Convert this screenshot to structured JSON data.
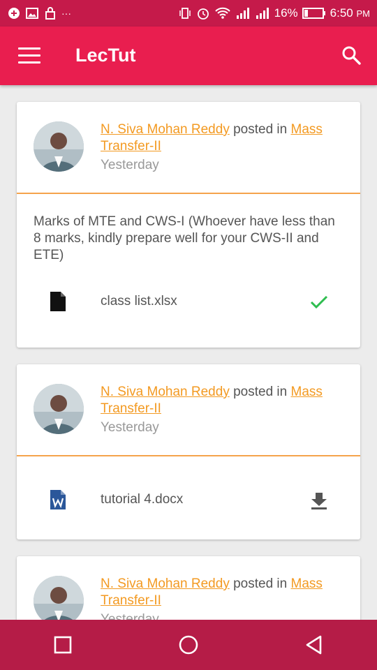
{
  "status_bar": {
    "battery": "16%",
    "time": "6:50",
    "ampm": "PM",
    "left_icons": [
      "notification-icon",
      "image-icon",
      "lock-icon",
      "more-icon"
    ],
    "right_icons": [
      "vibrate-icon",
      "alarm-icon",
      "wifi-icon",
      "signal-icon",
      "signal-icon",
      "battery-icon"
    ],
    "more": "···"
  },
  "app_bar": {
    "title": "LecTut",
    "menu_icon": "menu-icon",
    "search_icon": "search-icon"
  },
  "colors": {
    "primary": "#e91e4f",
    "status_bar": "#c51a4a",
    "nav_bar": "#b51c47",
    "link": "#f39a22",
    "divider": "#f5a34b",
    "check": "#2ebd4f",
    "word_blue": "#2b579a"
  },
  "posts": [
    {
      "author": "N. Siva Mohan Reddy",
      "connector": "posted in",
      "course": "Mass Transfer-II",
      "time": "Yesterday",
      "text": "Marks of MTE and CWS-I (Whoever have less than 8 marks, kindly prepare well for your CWS-II and ETE)",
      "attachment": {
        "name": "class list.xlsx",
        "icon": "file-icon",
        "action": "check-icon"
      }
    },
    {
      "author": "N. Siva Mohan Reddy",
      "connector": "posted in",
      "course": "Mass Transfer-II",
      "time": "Yesterday",
      "text": "",
      "attachment": {
        "name": "tutorial 4.docx",
        "icon": "word-doc-icon",
        "action": "download-icon"
      }
    },
    {
      "author": "N. Siva Mohan Reddy",
      "connector": "posted in",
      "course": "Mass Transfer-II",
      "time": "Yesterday"
    }
  ],
  "nav_bar": {
    "buttons": [
      "recents-square-icon",
      "home-circle-icon",
      "back-triangle-icon"
    ]
  }
}
